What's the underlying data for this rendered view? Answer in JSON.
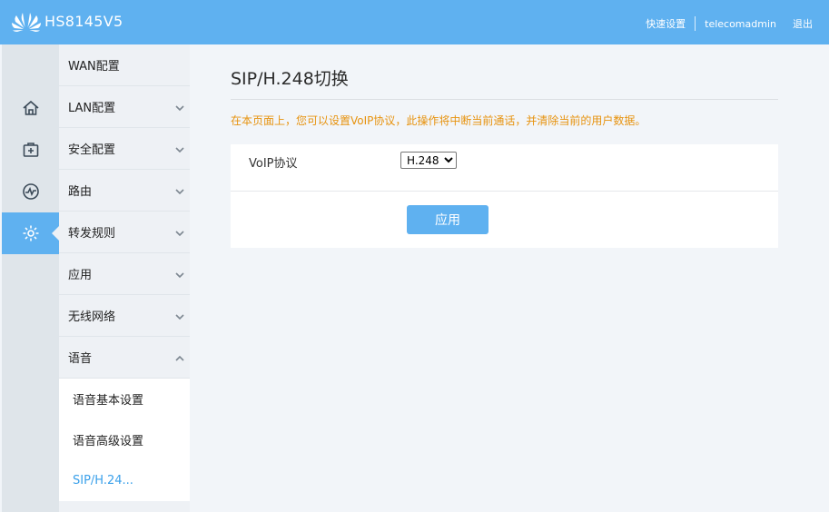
{
  "header": {
    "model": "HS8145V5",
    "links": {
      "quick_setup": "快速设置",
      "username": "telecomadmin",
      "logout": "退出"
    }
  },
  "rail": {
    "items": [
      {
        "icon": "home-icon"
      },
      {
        "icon": "first-aid-icon"
      },
      {
        "icon": "pulse-icon"
      },
      {
        "icon": "gear-icon",
        "active": true
      }
    ]
  },
  "menu": {
    "items": [
      {
        "label": "WAN配置"
      },
      {
        "label": "LAN配置"
      },
      {
        "label": "安全配置"
      },
      {
        "label": "路由"
      },
      {
        "label": "转发规则"
      },
      {
        "label": "应用"
      },
      {
        "label": "无线网络"
      },
      {
        "label": "语音"
      }
    ],
    "sub_items": [
      {
        "label": "语音基本设置"
      },
      {
        "label": "语音高级设置"
      },
      {
        "label": "SIP/H.24..."
      }
    ]
  },
  "main": {
    "title": "SIP/H.248切换",
    "notice": "在本页面上，您可以设置VoIP协议，此操作将中断当前通话，并清除当前的用户数据。",
    "voip_label": "VoIP协议",
    "voip_value": "H.248",
    "apply_label": "应用"
  },
  "colors": {
    "accent": "#5fb1f0",
    "notice": "#e7930f",
    "active_link": "#3aa0ea"
  }
}
